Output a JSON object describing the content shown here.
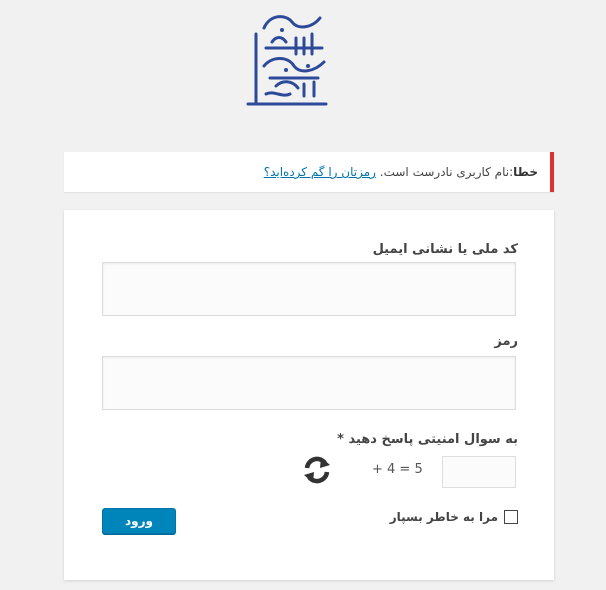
{
  "logo": {
    "alt_text": "سازمان نظام مهندسی",
    "color": "#2d4a9a"
  },
  "notice": {
    "error_prefix": "خطا",
    "message": ":نام کاربری نادرست است.",
    "link": "رمزتان را گم کرده‌اید؟",
    "border_color": "#dc3232"
  },
  "form": {
    "username_label": "کد ملی یا نشانی ایمیل",
    "username_value": "",
    "password_label": "رمز",
    "password_value": "",
    "captcha_label": "به سوال امنیتی پاسخ دهید *",
    "captcha_value": "",
    "captcha_expression": "+ 4 = 5",
    "refresh_icon": "refresh-icon",
    "remember_label": "مرا به خاطر بسپار",
    "remember_checked": false,
    "submit_label": "ورود",
    "accent": "#0085ba"
  }
}
